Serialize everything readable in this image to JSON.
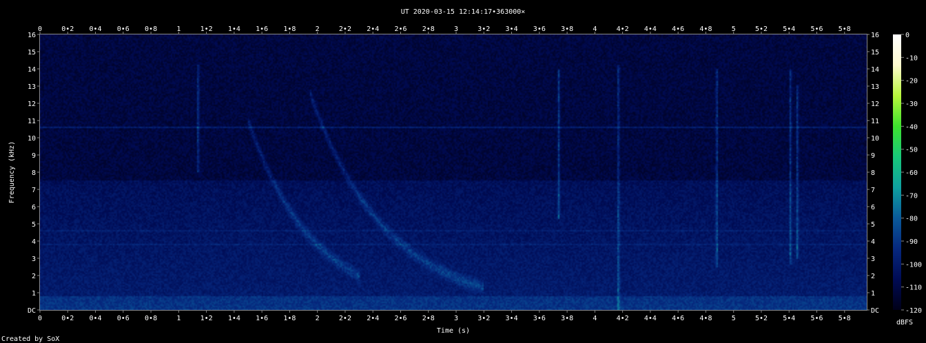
{
  "title": "UT 2020-03-15 12:14:17•363000×",
  "footer": "Created by SoX",
  "chart_data": {
    "type": "heatmap",
    "subtype": "spectrogram",
    "xlabel": "Time (s)",
    "ylabel": "Frequency (kHz)",
    "xlim": [
      0,
      5.96
    ],
    "ylim": [
      0,
      16
    ],
    "x_ticks": [
      "0",
      "0•2",
      "0•4",
      "0•6",
      "0•8",
      "1",
      "1•2",
      "1•4",
      "1•6",
      "1•8",
      "2",
      "2•2",
      "2•4",
      "2•6",
      "2•8",
      "3",
      "3•2",
      "3•4",
      "3•6",
      "3•8",
      "4",
      "4•2",
      "4•4",
      "4•6",
      "4•8",
      "5",
      "5•2",
      "5•4",
      "5•6",
      "5•8"
    ],
    "x_tick_values": [
      0,
      0.2,
      0.4,
      0.6,
      0.8,
      1,
      1.2,
      1.4,
      1.6,
      1.8,
      2,
      2.2,
      2.4,
      2.6,
      2.8,
      3,
      3.2,
      3.4,
      3.6,
      3.8,
      4,
      4.2,
      4.4,
      4.6,
      4.8,
      5,
      5.2,
      5.4,
      5.6,
      5.8
    ],
    "y_ticks": [
      "DC",
      "1",
      "2",
      "3",
      "4",
      "5",
      "6",
      "7",
      "8",
      "9",
      "10",
      "11",
      "12",
      "13",
      "14",
      "15",
      "16"
    ],
    "y_tick_values": [
      0,
      1,
      2,
      3,
      4,
      5,
      6,
      7,
      8,
      9,
      10,
      11,
      12,
      13,
      14,
      15,
      16
    ],
    "colorbar": {
      "label": "dBFS",
      "ticks": [
        "0",
        "-10",
        "-20",
        "-30",
        "-40",
        "-50",
        "-60",
        "-70",
        "-80",
        "-90",
        "-100",
        "-110",
        "-120"
      ],
      "tick_values": [
        0,
        -10,
        -20,
        -30,
        -40,
        -50,
        -60,
        -70,
        -80,
        -90,
        -100,
        -110,
        -120
      ],
      "range": [
        -120,
        0
      ],
      "colors": [
        "#000018",
        "#000b54",
        "#06287e",
        "#0a5a9a",
        "#0fa0a0",
        "#18c87a",
        "#3ee22e",
        "#b8f63c",
        "#fffbd0",
        "#ffffff"
      ]
    },
    "features": {
      "background_level_db": -110,
      "horizontal_tone_khz": 10.6,
      "low_band_khz": [
        0,
        7.5
      ],
      "whistlers": [
        {
          "t_start": 1.5,
          "f_start": 11.0,
          "t_end": 2.3,
          "f_end": 2.0
        },
        {
          "t_start": 1.95,
          "f_start": 12.5,
          "t_end": 3.2,
          "f_end": 1.3
        }
      ],
      "vertical_impulses": [
        {
          "t": 1.14,
          "f_low": 8.0,
          "f_high": 14.2
        },
        {
          "t": 3.74,
          "f_low": 5.3,
          "f_high": 14.0
        },
        {
          "t": 4.17,
          "f_low": 0.0,
          "f_high": 14.2
        },
        {
          "t": 4.88,
          "f_low": 2.5,
          "f_high": 14.0
        },
        {
          "t": 5.41,
          "f_low": 2.6,
          "f_high": 14.0
        },
        {
          "t": 5.46,
          "f_low": 3.0,
          "f_high": 13.0
        }
      ]
    }
  }
}
